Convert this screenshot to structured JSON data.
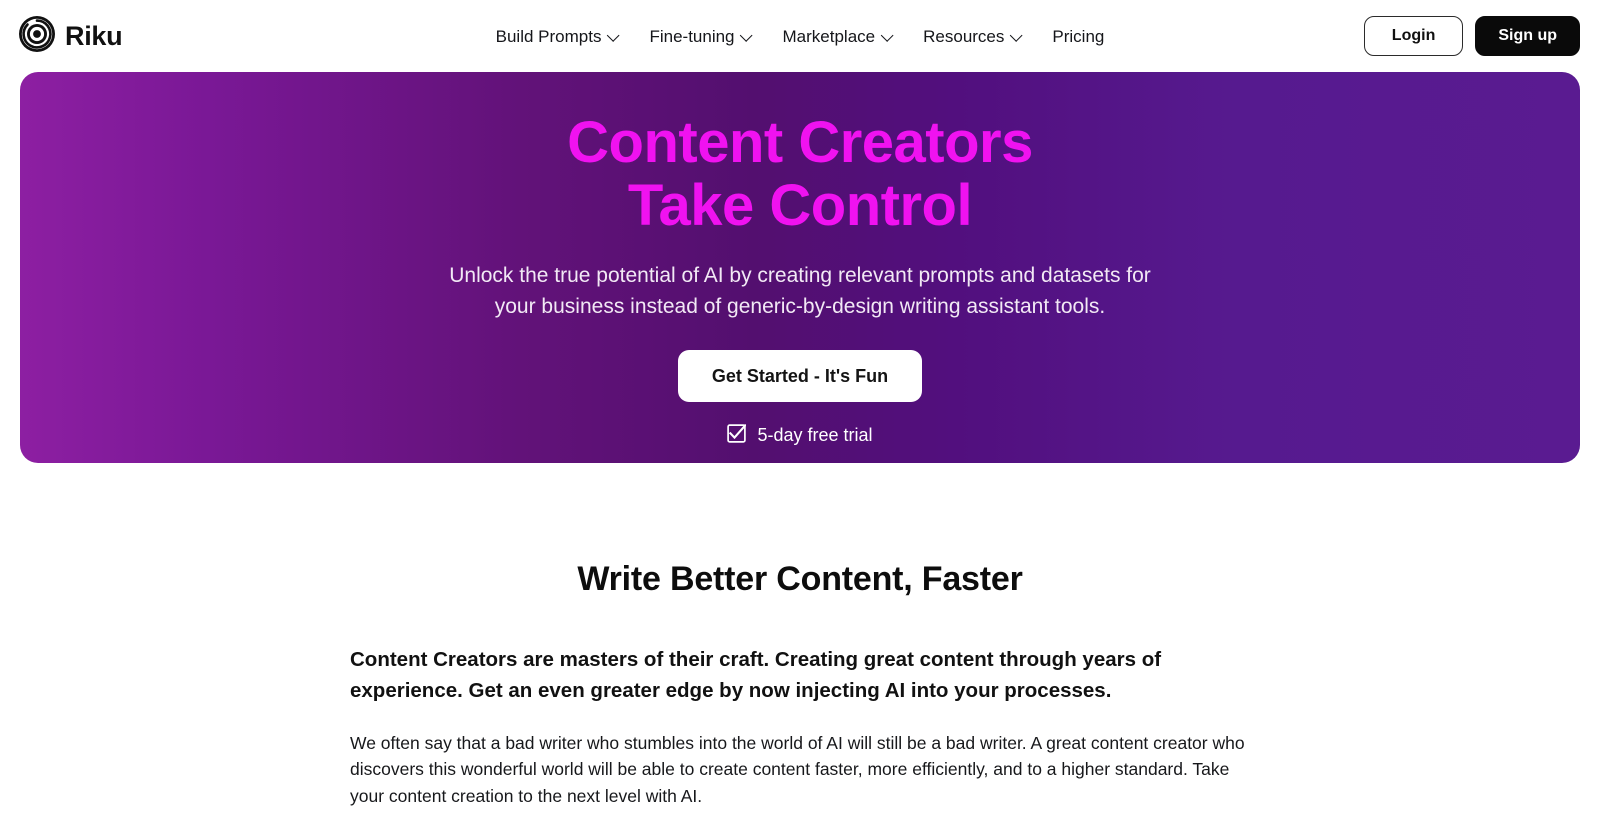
{
  "header": {
    "brand": {
      "name": "Riku",
      "logo_icon": "riku-circle-logo-icon"
    },
    "nav": [
      {
        "label": "Build Prompts",
        "has_dropdown": true
      },
      {
        "label": "Fine-tuning",
        "has_dropdown": true
      },
      {
        "label": "Marketplace",
        "has_dropdown": true
      },
      {
        "label": "Resources",
        "has_dropdown": true
      },
      {
        "label": "Pricing",
        "has_dropdown": false
      }
    ],
    "actions": {
      "login_label": "Login",
      "signup_label": "Sign up"
    }
  },
  "hero": {
    "title_line1": "Content Creators",
    "title_line2": "Take Control",
    "subtitle_line1": "Unlock the true potential of AI by creating relevant prompts and datasets for",
    "subtitle_line2": "your business instead of generic-by-design writing assistant tools.",
    "cta_label": "Get Started - It's Fun",
    "trial_label": "5-day free trial",
    "trial_icon": "checkbox-checked-icon",
    "colors": {
      "title": "#f012f0",
      "gradient_left": "#8d1fa2",
      "gradient_mid": "#530f6f",
      "gradient_right": "#5a1b91",
      "subtitle": "#f2e9f5",
      "cta_bg": "#ffffff",
      "cta_text": "#141414"
    }
  },
  "main": {
    "section_heading": "Write Better Content, Faster",
    "lead_paragraph": "Content Creators are masters of their craft. Creating great content through years of experience. Get an even greater edge by now injecting AI into your processes.",
    "body_paragraph": "We often say that a bad writer who stumbles into the world of AI will still be a bad writer. A great content creator who discovers this wonderful world  will be able to create content faster, more efficiently, and to a higher standard. Take your content creation to the next level with AI."
  }
}
